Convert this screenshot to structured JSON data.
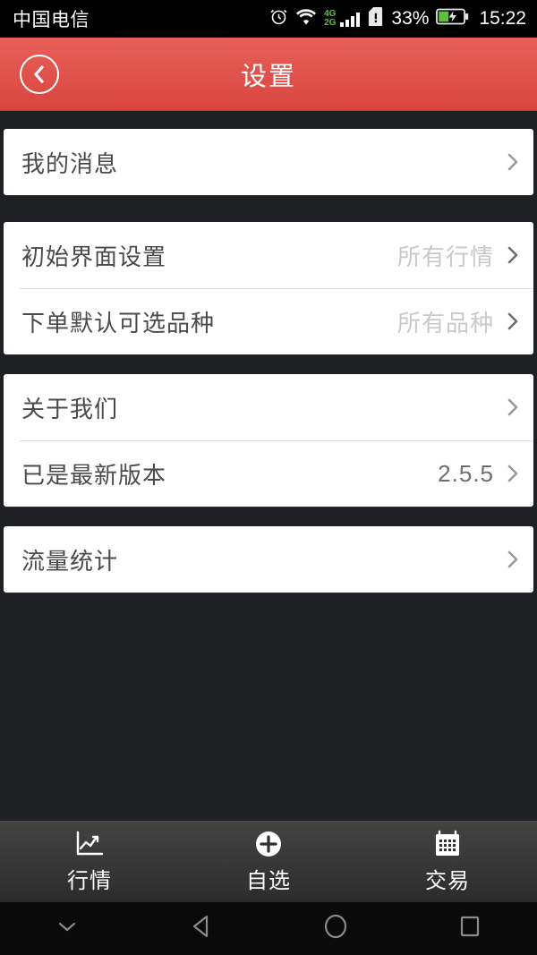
{
  "status_bar": {
    "carrier": "中国电信",
    "alarm_icon": "alarm-clock-icon",
    "wifi_icon": "wifi-icon",
    "network_primary": "4G",
    "network_secondary": "2G",
    "signal_icon": "signal-bars-icon",
    "sim_icon": "sim-card-alert-icon",
    "battery_percent": "33%",
    "battery_icon": "battery-charging-icon",
    "clock": "15:22"
  },
  "header": {
    "title": "设置",
    "back_icon": "back-chevron-icon"
  },
  "groups": [
    {
      "rows": [
        {
          "label": "我的消息",
          "value": "",
          "value_style": "light",
          "chevron": "chevron-right-icon"
        }
      ]
    },
    {
      "rows": [
        {
          "label": "初始界面设置",
          "value": "所有行情",
          "value_style": "light",
          "chevron": "chevron-right-icon"
        },
        {
          "label": "下单默认可选品种",
          "value": "所有品种",
          "value_style": "light",
          "chevron": "chevron-right-icon"
        }
      ]
    },
    {
      "rows": [
        {
          "label": "关于我们",
          "value": "",
          "value_style": "light",
          "chevron": "chevron-right-icon"
        },
        {
          "label": "已是最新版本",
          "value": "2.5.5",
          "value_style": "dark",
          "chevron": "chevron-right-icon"
        }
      ]
    },
    {
      "rows": [
        {
          "label": "流量统计",
          "value": "",
          "value_style": "light",
          "chevron": "chevron-right-icon"
        }
      ]
    }
  ],
  "tabbar": {
    "tabs": [
      {
        "label": "行情",
        "icon": "line-chart-icon"
      },
      {
        "label": "自选",
        "icon": "plus-circle-icon"
      },
      {
        "label": "交易",
        "icon": "calendar-icon"
      }
    ]
  },
  "android_nav": {
    "hide_icon": "chevron-down-icon",
    "back_icon": "triangle-back-icon",
    "home_icon": "circle-home-icon",
    "recents_icon": "square-recents-icon"
  },
  "colors": {
    "header_red": "#e0544d",
    "page_background": "#1e2023",
    "card": "#ffffff",
    "label_text": "#4a4a4a",
    "value_light": "#c9c9c9",
    "value_dark": "#6e6e6e",
    "battery_green": "#5fbf3f"
  }
}
